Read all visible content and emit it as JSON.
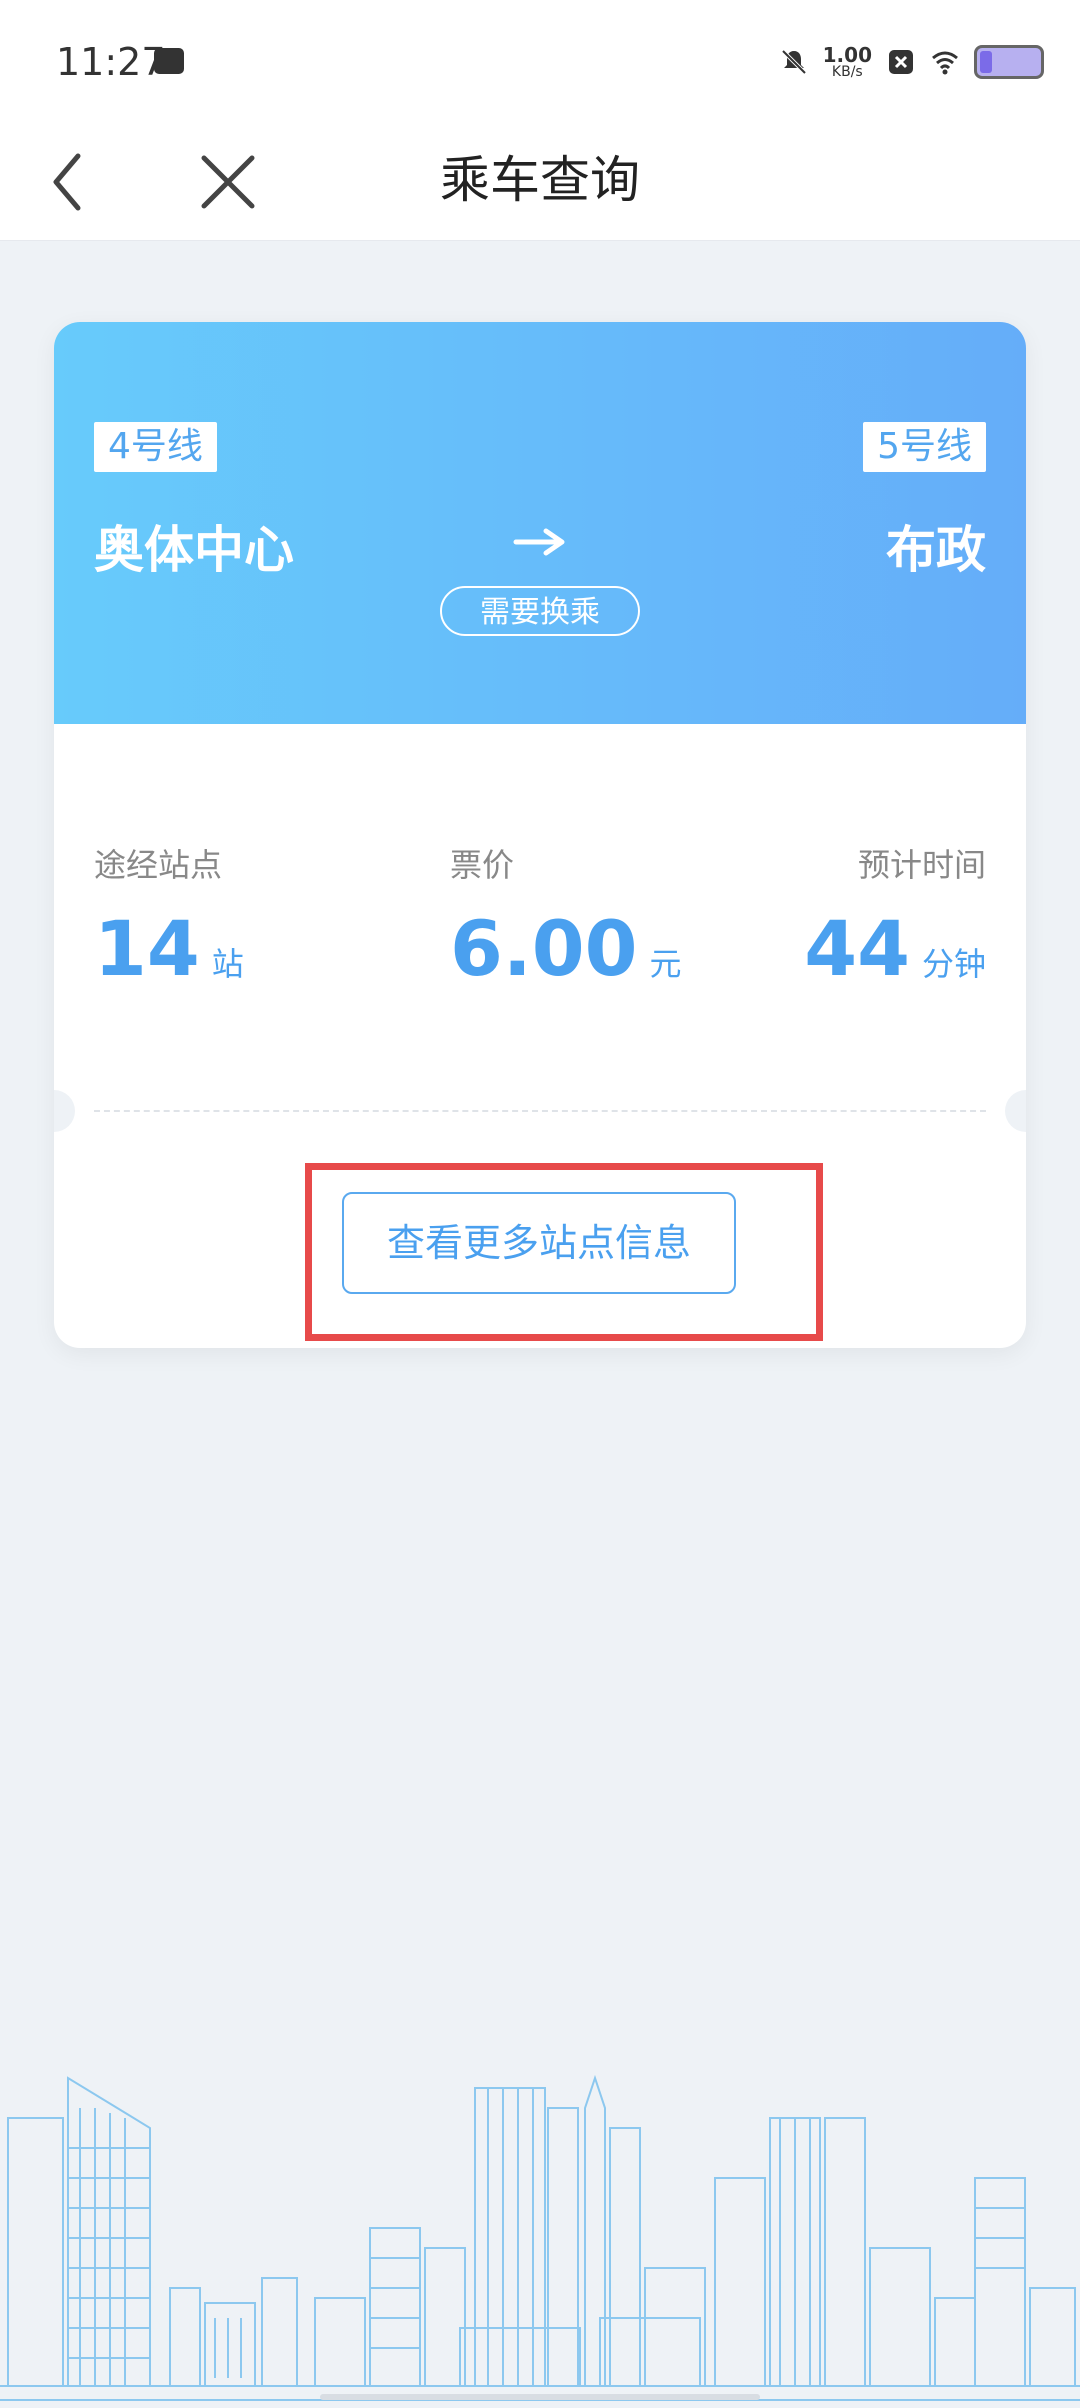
{
  "status": {
    "time": "11:27",
    "speed_value": "1.00",
    "speed_unit": "KB/s"
  },
  "nav": {
    "title": "乘车查询"
  },
  "route": {
    "from_line": "4号线",
    "to_line": "5号线",
    "from_station": "奥体中心",
    "to_station": "布政",
    "transfer": "需要换乘"
  },
  "stats": {
    "stations": {
      "label": "途经站点",
      "value": "14",
      "unit": "站"
    },
    "fare": {
      "label": "票价",
      "value": "6.00",
      "unit": "元"
    },
    "time": {
      "label": "预计时间",
      "value": "44",
      "unit": "分钟"
    }
  },
  "actions": {
    "more_info": "查看更多站点信息"
  },
  "colors": {
    "accent": "#4aa0ef",
    "gradient_start": "#67cbfb",
    "gradient_end": "#65adf9",
    "highlight": "#e74a4a"
  }
}
